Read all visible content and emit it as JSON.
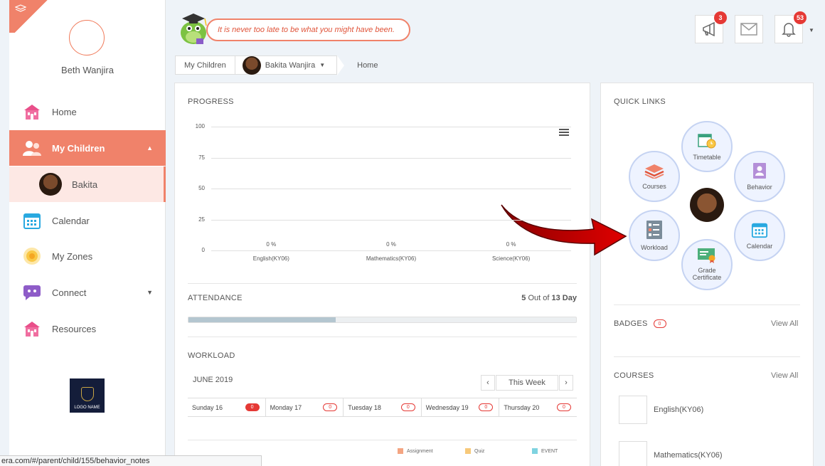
{
  "sidebar": {
    "user_name": "Beth Wanjira",
    "items": [
      {
        "label": "Home",
        "icon": "home-icon"
      },
      {
        "label": "My Children",
        "icon": "children-icon"
      },
      {
        "label": "Bakita",
        "icon": "child-avatar"
      },
      {
        "label": "Calendar",
        "icon": "calendar-icon"
      },
      {
        "label": "My Zones",
        "icon": "zones-icon"
      },
      {
        "label": "Connect",
        "icon": "connect-icon"
      },
      {
        "label": "Resources",
        "icon": "resources-icon"
      }
    ],
    "logo_text": "LOGO NAME"
  },
  "header": {
    "quote": "It is never too late to be what you might have been.",
    "announcements_count": "3",
    "notifications_count": "53"
  },
  "breadcrumb": {
    "root": "My Children",
    "child": "Bakita Wanjira",
    "current": "Home"
  },
  "progress": {
    "title": "PROGRESS",
    "y_ticks": [
      "100",
      "75",
      "50",
      "25",
      "0"
    ],
    "bar_labels": [
      "0 %",
      "0 %",
      "0 %"
    ]
  },
  "chart_data": {
    "type": "bar",
    "title": "PROGRESS",
    "categories": [
      "English(KY06)",
      "Mathematics(KY06)",
      "Science(KY06)"
    ],
    "values": [
      0,
      0,
      0
    ],
    "ylim": [
      0,
      100
    ]
  },
  "attendance": {
    "title": "ATTENDANCE",
    "present": "5",
    "out_of_label": "Out of",
    "total": "13 Day",
    "fill_fraction": 0.38
  },
  "workload": {
    "title": "WORKLOAD",
    "month": "JUNE 2019",
    "range_label": "This Week",
    "days": [
      {
        "label": "Sunday 16",
        "count": "0",
        "filled": true
      },
      {
        "label": "Monday 17",
        "count": "0",
        "filled": false
      },
      {
        "label": "Tuesday 18",
        "count": "0",
        "filled": false
      },
      {
        "label": "Wednesday 19",
        "count": "0",
        "filled": false
      },
      {
        "label": "Thursday 20",
        "count": "0",
        "filled": false
      }
    ],
    "legend": [
      {
        "label": "Assignment",
        "color": "#f4a582"
      },
      {
        "label": "Quiz",
        "color": "#f7c97a"
      },
      {
        "label": "EVENT",
        "color": "#7fd3e0"
      }
    ]
  },
  "quick_links": {
    "title": "QUICK LINKS",
    "items": {
      "timetable": "Timetable",
      "courses": "Courses",
      "behavior": "Behavior",
      "workload": "Workload",
      "calendar": "Calendar",
      "grade_certificate": "Grade Certificate"
    }
  },
  "badges": {
    "title": "BADGES",
    "count": "0",
    "view_all": "View All"
  },
  "courses": {
    "title": "COURSES",
    "view_all": "View All",
    "list": [
      "English(KY06)",
      "Mathematics(KY06)"
    ]
  },
  "status_url": "era.com/#/parent/child/155/behavior_notes"
}
